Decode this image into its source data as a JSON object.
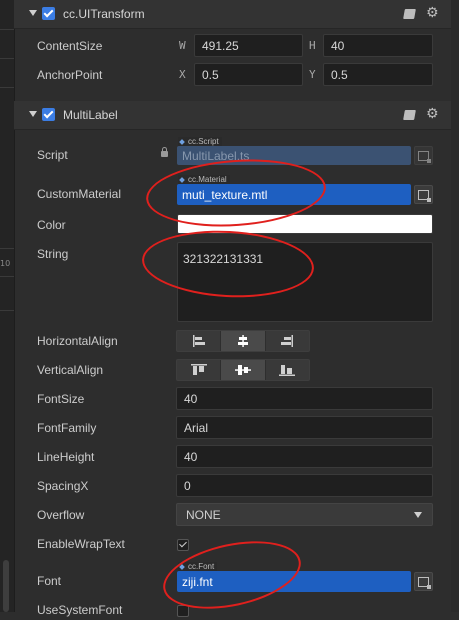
{
  "ui_transform": {
    "title": "cc.UITransform",
    "content_size_label": "ContentSize",
    "anchor_point_label": "AnchorPoint",
    "w_label": "W",
    "h_label": "H",
    "x_label": "X",
    "y_label": "Y",
    "width": "491.25",
    "height": "40",
    "anchor_x": "0.5",
    "anchor_y": "0.5"
  },
  "multi_label": {
    "title": "MultiLabel",
    "script": {
      "label": "Script",
      "type_tag": "cc.Script",
      "value": "MultiLabel.ts"
    },
    "custom_material": {
      "label": "CustomMaterial",
      "type_tag": "cc.Material",
      "value": "muti_texture.mtl"
    },
    "color": {
      "label": "Color",
      "value": "#ffffff"
    },
    "string": {
      "label": "String",
      "value": "321322131331"
    },
    "horizontal_align": {
      "label": "HorizontalAlign",
      "options": [
        "left",
        "center",
        "right"
      ],
      "selected": "center"
    },
    "vertical_align": {
      "label": "VerticalAlign",
      "options": [
        "top",
        "center",
        "bottom"
      ],
      "selected": "center"
    },
    "font_size": {
      "label": "FontSize",
      "value": "40"
    },
    "font_family": {
      "label": "FontFamily",
      "value": "Arial"
    },
    "line_height": {
      "label": "LineHeight",
      "value": "40"
    },
    "spacing_x": {
      "label": "SpacingX",
      "value": "0"
    },
    "overflow": {
      "label": "Overflow",
      "value": "NONE"
    },
    "enable_wrap_text": {
      "label": "EnableWrapText",
      "checked": true
    },
    "font": {
      "label": "Font",
      "type_tag": "cc.Font",
      "value": "ziji.fnt"
    },
    "use_system_font": {
      "label": "UseSystemFont",
      "checked": false
    }
  },
  "left_strip": {
    "number_fragment": "10"
  },
  "colors": {
    "panel_bg": "#2d2d2d",
    "header_bg": "#333333",
    "input_bg": "#1f1f1f",
    "accent_blue": "#1e5fc1",
    "check_blue": "#3b7de4",
    "annotation_red": "#e0201d"
  },
  "icons": [
    "book-icon",
    "gear-icon",
    "lock-icon",
    "asset-picker-icon",
    "dropdown-arrow-icon",
    "checkmark-icon",
    "collapse-caret-icon"
  ]
}
